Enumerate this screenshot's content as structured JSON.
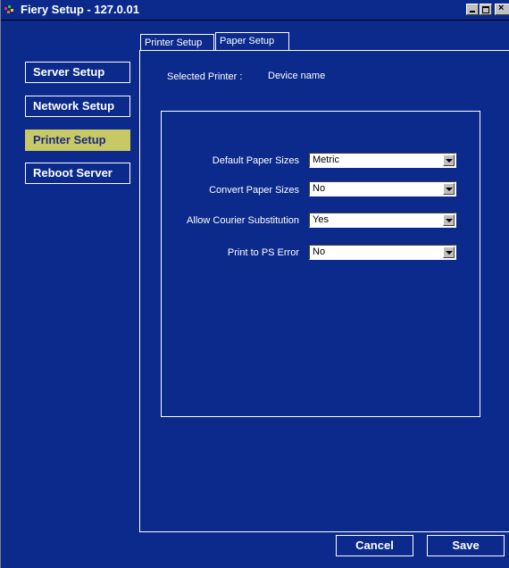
{
  "window": {
    "title": "Fiery Setup - 127.0.01"
  },
  "nav": {
    "items": [
      {
        "label": "Server Setup",
        "active": false
      },
      {
        "label": "Network Setup",
        "active": false
      },
      {
        "label": "Printer Setup",
        "active": true
      },
      {
        "label": "Reboot Server",
        "active": false
      }
    ]
  },
  "tabs": [
    {
      "label": "Printer Setup",
      "selected": false
    },
    {
      "label": "Paper Setup",
      "selected": true
    }
  ],
  "selected_printer": {
    "label": "Selected Printer :",
    "value": "Device name"
  },
  "settings": [
    {
      "label": "Default Paper Sizes",
      "value": "Metric"
    },
    {
      "label": "Convert Paper Sizes",
      "value": "No"
    },
    {
      "label": "Allow Courier Substitution",
      "value": "Yes"
    },
    {
      "label": "Print to PS Error",
      "value": "No"
    }
  ],
  "actions": {
    "cancel": "Cancel",
    "save": "Save"
  },
  "colors": {
    "background": "#0b2a8c",
    "active_nav": "#c8c864",
    "text": "#ffffff"
  }
}
